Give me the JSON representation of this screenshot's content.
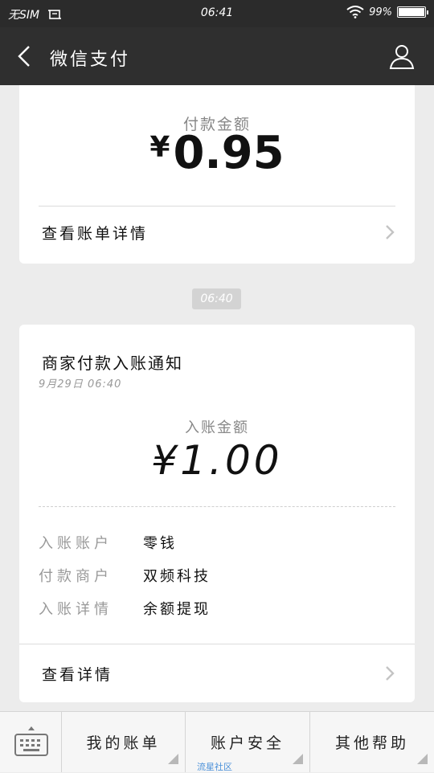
{
  "status_bar": {
    "carrier": "无SIM",
    "time": "06:41",
    "battery_text": "99%",
    "battery_level": 0.99
  },
  "nav": {
    "title": "微信支付",
    "back_icon": "chevron-left-icon",
    "profile_icon": "user-icon"
  },
  "payment_card": {
    "amount_label": "付款金额",
    "currency": "¥",
    "amount": "0.95",
    "link_label": "查看账单详情"
  },
  "time_divider": "06:40",
  "notice_card": {
    "title": "商家付款入账通知",
    "date": "9月29日  06:40",
    "amount_label": "入账金额",
    "amount": "¥1.00",
    "details": [
      {
        "key": "入账账户",
        "value": "零钱"
      },
      {
        "key": "付款商户",
        "value": "双频科技"
      },
      {
        "key": "入账详情",
        "value": "余额提现"
      }
    ],
    "link_label": "查看详情"
  },
  "bottom_menu": {
    "keyboard_icon": "keyboard-icon",
    "items": [
      {
        "label": "我的账单"
      },
      {
        "label": "账户安全"
      },
      {
        "label": "其他帮助"
      }
    ]
  },
  "watermark": "流星社区",
  "colors": {
    "nav_bg": "#2f2f2f",
    "status_bg": "#2b2b2b",
    "page_bg": "#ececec",
    "chip_bg": "#d3d3d3"
  }
}
